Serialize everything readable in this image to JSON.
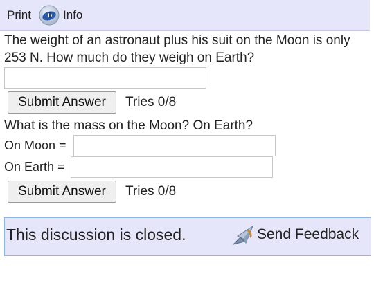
{
  "topbar": {
    "print_label": "Print",
    "info_label": "Info",
    "info_icon": "info-globe-icon"
  },
  "problem1": {
    "question": "The weight of an astronaut plus his suit on the Moon is only 253 N. How much do they weigh on Earth?",
    "submit_label": "Submit Answer",
    "tries": "Tries 0/8",
    "answer_value": ""
  },
  "problem2": {
    "question": "What is the mass on the Moon? On Earth?",
    "moon_label": "On Moon =",
    "earth_label": "On Earth =",
    "moon_value": "",
    "earth_value": "",
    "submit_label": "Submit Answer",
    "tries": "Tries 0/8"
  },
  "discussion": {
    "closed_text": "This discussion is closed.",
    "feedback_label": "Send Feedback",
    "feedback_icon": "send-feedback-icon"
  }
}
